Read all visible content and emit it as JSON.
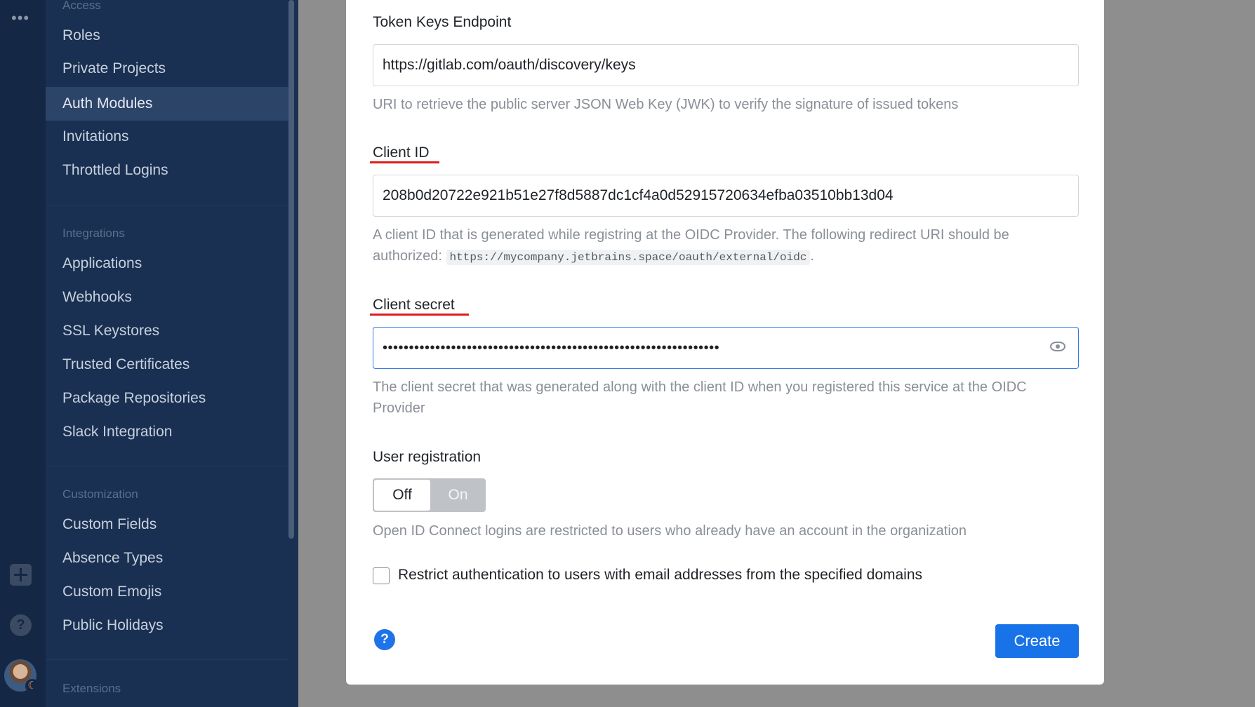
{
  "rail": {
    "more_glyph": "•••",
    "help_glyph": "?"
  },
  "sidebar": {
    "sections": [
      {
        "title": "Access",
        "items": [
          "Roles",
          "Private Projects",
          "Auth Modules",
          "Invitations",
          "Throttled Logins"
        ]
      },
      {
        "title": "Integrations",
        "items": [
          "Applications",
          "Webhooks",
          "SSL Keystores",
          "Trusted Certificates",
          "Package Repositories",
          "Slack Integration"
        ]
      },
      {
        "title": "Customization",
        "items": [
          "Custom Fields",
          "Absence Types",
          "Custom Emojis",
          "Public Holidays"
        ]
      },
      {
        "title": "Extensions",
        "items": []
      }
    ],
    "active_item": "Auth Modules"
  },
  "form": {
    "token_keys": {
      "label": "Token Keys Endpoint",
      "value": "https://gitlab.com/oauth/discovery/keys",
      "help": "URI to retrieve the public server JSON Web Key (JWK) to verify the signature of issued tokens"
    },
    "client_id": {
      "label": "Client ID",
      "value": "208b0d20722e921b51e27f8d5887dc1cf4a0d52915720634efba03510bb13d04",
      "help_before": "A client ID that is generated while registring at the OIDC Provider. The following redirect URI should be authorized: ",
      "help_code": "https://mycompany.jetbrains.space/oauth/external/oidc",
      "help_after": "."
    },
    "client_secret": {
      "label": "Client secret",
      "masked_value": "••••••••••••••••••••••••••••••••••••••••••••••••••••••••••••••••",
      "help": "The client secret that was generated along with the client ID when you registered this service at the OIDC Provider"
    },
    "user_registration": {
      "label": "User registration",
      "off_label": "Off",
      "on_label": "On",
      "selected": "Off",
      "help": "Open ID Connect logins are restricted to users who already have an account in the organization"
    },
    "restrict_domains": {
      "label": "Restrict authentication to users with email addresses from the specified domains",
      "checked": false
    },
    "help_glyph": "?",
    "create_label": "Create"
  },
  "colors": {
    "accent": "#1872e8",
    "annotation_underline": "#e01b1b",
    "sidebar_bg": "#1a3052"
  }
}
